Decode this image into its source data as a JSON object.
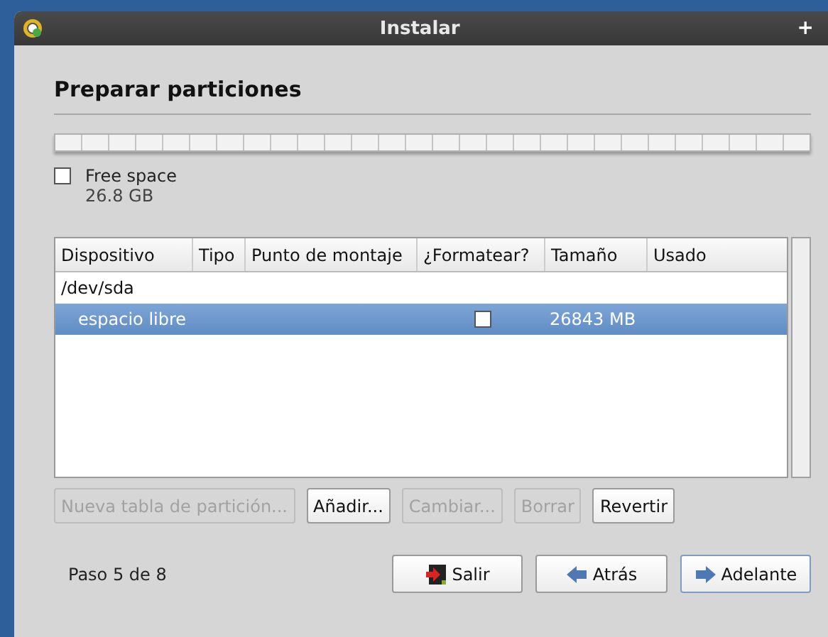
{
  "window": {
    "title": "Instalar",
    "title_buttons": [
      "+"
    ]
  },
  "heading": "Preparar particiones",
  "partition_bar": {
    "segments": [
      {
        "label": "Free space",
        "size": "26.8 GB",
        "checked": false
      }
    ]
  },
  "table": {
    "columns": [
      "Dispositivo",
      "Tipo",
      "Punto de montaje",
      "¿Formatear?",
      "Tamaño",
      "Usado"
    ],
    "rows": [
      {
        "kind": "device",
        "device": "/dev/sda",
        "selected": false
      },
      {
        "kind": "partition",
        "device": "espacio libre",
        "format": false,
        "size": "26843 MB",
        "selected": true
      }
    ]
  },
  "actions": [
    {
      "label": "Nueva tabla de partición...",
      "disabled": true
    },
    {
      "label": "Añadir...",
      "disabled": false
    },
    {
      "label": "Cambiar...",
      "disabled": true
    },
    {
      "label": "Borrar",
      "disabled": true
    },
    {
      "label": "Revertir",
      "disabled": false
    }
  ],
  "step": "Paso 5 de 8",
  "nav": [
    {
      "kind": "quit",
      "label": "Salir",
      "focused": false
    },
    {
      "kind": "back",
      "label": "Atrás",
      "focused": false
    },
    {
      "kind": "forward",
      "label": "Adelante",
      "focused": true
    }
  ]
}
